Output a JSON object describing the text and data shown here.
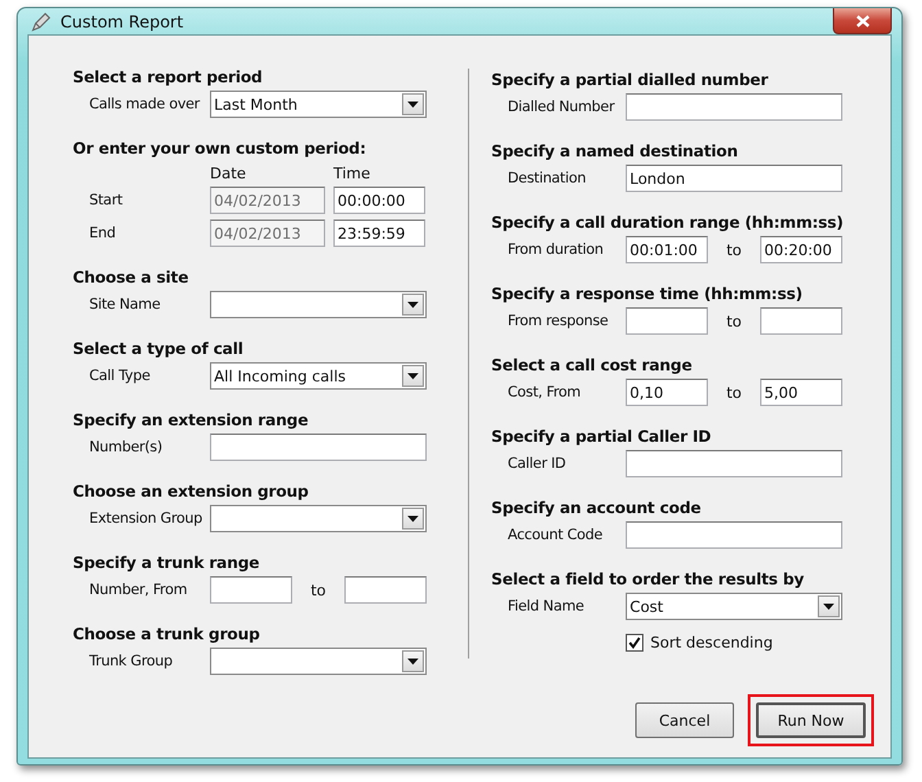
{
  "window": {
    "title": "Custom Report"
  },
  "columns": [
    {
      "sections": [
        {
          "heading": "Select a report period",
          "rows": [
            {
              "kind": "dropdown",
              "label": "Calls made over",
              "value": "Last Month"
            }
          ]
        },
        {
          "heading": "Or enter your own custom period:",
          "rows": [
            {
              "kind": "headers",
              "headers": [
                "Date",
                "Time"
              ]
            },
            {
              "kind": "datetime",
              "label": "Start",
              "fields": [
                {
                  "value": "04/02/2013",
                  "disabled": true
                },
                {
                  "value": "00:00:00",
                  "disabled": false
                }
              ]
            },
            {
              "kind": "datetime",
              "label": "End",
              "fields": [
                {
                  "value": "04/02/2013",
                  "disabled": true
                },
                {
                  "value": "23:59:59",
                  "disabled": false
                }
              ]
            }
          ]
        },
        {
          "heading": "Choose a site",
          "rows": [
            {
              "kind": "dropdown",
              "label": "Site Name"
            }
          ]
        },
        {
          "heading": "Select a type of call",
          "rows": [
            {
              "kind": "dropdown",
              "label": "Call Type",
              "value": "All Incoming calls"
            }
          ]
        },
        {
          "heading": "Specify an extension range",
          "rows": [
            {
              "kind": "text",
              "label": "Number(s)"
            }
          ]
        },
        {
          "heading": "Choose an extension group",
          "rows": [
            {
              "kind": "dropdown",
              "label": "Extension Group"
            }
          ]
        },
        {
          "heading": "Specify a trunk range",
          "rows": [
            {
              "kind": "range",
              "label": "Number, From",
              "separator": "to"
            }
          ]
        },
        {
          "heading": "Choose a trunk group",
          "rows": [
            {
              "kind": "dropdown",
              "label": "Trunk Group"
            }
          ]
        }
      ]
    },
    {
      "sections": [
        {
          "heading": "Specify a partial dialled number",
          "rows": [
            {
              "kind": "text",
              "label": "Dialled Number"
            }
          ]
        },
        {
          "heading": "Specify a named destination",
          "rows": [
            {
              "kind": "text",
              "label": "Destination",
              "value": "London"
            }
          ]
        },
        {
          "heading": "Specify a call duration range (hh:mm:ss)",
          "rows": [
            {
              "kind": "range",
              "label": "From duration",
              "from": "00:01:00",
              "separator": "to",
              "to": "00:20:00"
            }
          ]
        },
        {
          "heading": "Specify a response time (hh:mm:ss)",
          "rows": [
            {
              "kind": "range",
              "label": "From response",
              "separator": "to"
            }
          ]
        },
        {
          "heading": "Select a call cost range",
          "rows": [
            {
              "kind": "range",
              "label": "Cost, From",
              "from": "0,10",
              "separator": "to",
              "to": "5,00"
            }
          ]
        },
        {
          "heading": "Specify a partial Caller ID",
          "rows": [
            {
              "kind": "text",
              "label": "Caller ID"
            }
          ]
        },
        {
          "heading": "Specify an account code",
          "rows": [
            {
              "kind": "text",
              "label": "Account Code"
            }
          ]
        },
        {
          "heading": "Select a field to order the results by",
          "rows": [
            {
              "kind": "dropdown",
              "label": "Field Name",
              "value": "Cost"
            },
            {
              "kind": "checkbox",
              "label": "Sort descending",
              "checked": true
            }
          ]
        }
      ]
    }
  ],
  "buttons": [
    {
      "label": "Cancel",
      "highlighted": false
    },
    {
      "label": "Run Now",
      "highlighted": true
    }
  ]
}
